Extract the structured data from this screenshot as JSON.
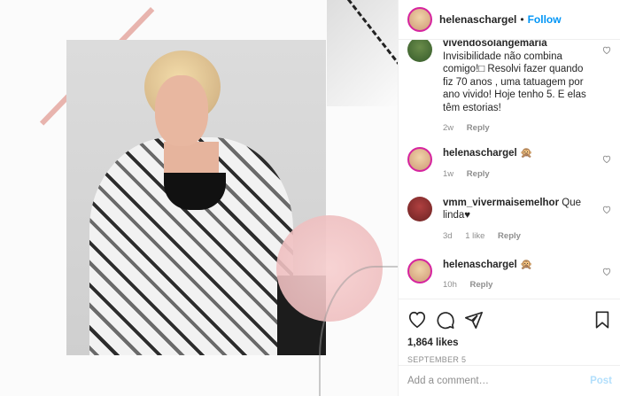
{
  "post": {
    "author": "helenaschargel",
    "dot": "•",
    "follow_label": "Follow"
  },
  "comments": [
    {
      "username": "vivendosolangemaria",
      "text": "Invisibilidade não combina comigo!□ Resolvi fazer quando fiz 70 anos , uma tatuagem por ano vivido! Hoje tenho 5. E elas têm estorias!",
      "age": "2w",
      "likes": "",
      "reply_label": "Reply",
      "avatar": "green"
    },
    {
      "username": "helenaschargel",
      "text": "🙊",
      "age": "1w",
      "likes": "",
      "reply_label": "Reply",
      "avatar": "author"
    },
    {
      "username": "vmm_vivermaisemelhor",
      "text": "Que linda♥",
      "age": "3d",
      "likes": "1 like",
      "reply_label": "Reply",
      "avatar": "dark"
    },
    {
      "username": "helenaschargel",
      "text": "🙊",
      "age": "10h",
      "likes": "",
      "reply_label": "Reply",
      "avatar": "author"
    }
  ],
  "actions": {
    "like_icon": "heart-outline-icon",
    "comment_icon": "comment-bubble-icon",
    "share_icon": "paper-plane-icon",
    "save_icon": "bookmark-icon"
  },
  "likes_text": "1,864 likes",
  "date_text": "SEPTEMBER 5",
  "add_comment": {
    "placeholder": "Add a comment…",
    "post_label": "Post"
  },
  "colors": {
    "follow": "#0095f6",
    "post_disabled": "#b2dffc",
    "muted": "#8e8e8e",
    "text": "#262626",
    "border": "#efefef"
  }
}
